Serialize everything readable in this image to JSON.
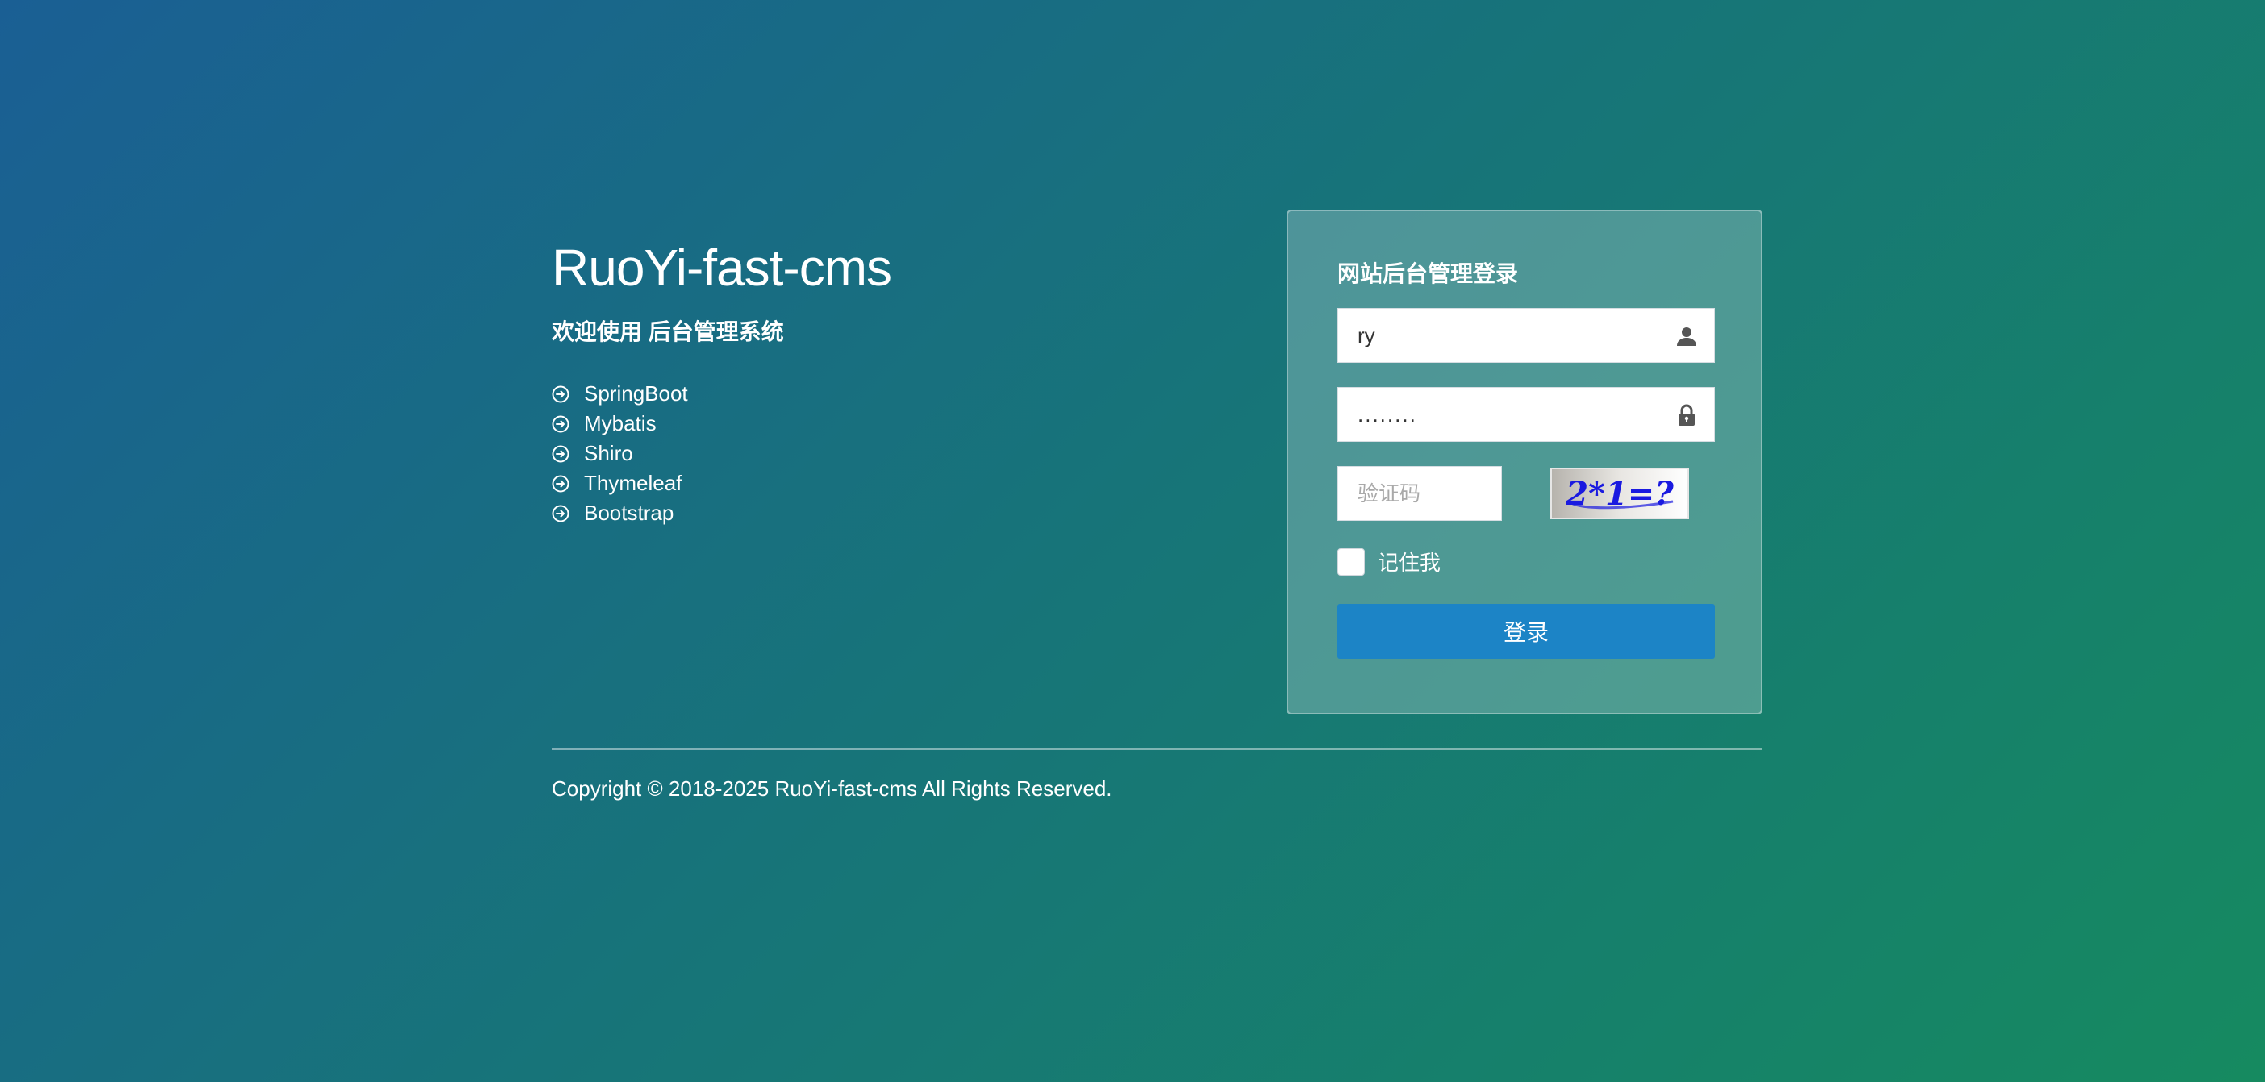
{
  "intro": {
    "brand": "RuoYi-fast-cms",
    "welcome": "欢迎使用 后台管理系统",
    "technologies": [
      "SpringBoot",
      "Mybatis",
      "Shiro",
      "Thymeleaf",
      "Bootstrap"
    ]
  },
  "login": {
    "title": "网站后台管理登录",
    "username": {
      "value": "ry",
      "icon": "user-icon"
    },
    "password": {
      "value": "........",
      "icon": "lock-icon"
    },
    "captcha": {
      "placeholder": "验证码",
      "image_text": "2*1=?"
    },
    "remember_label": "记住我",
    "submit_label": "登录"
  },
  "footer": {
    "copyright": "Copyright © 2018-2025 RuoYi-fast-cms All Rights Reserved."
  },
  "colors": {
    "background_start": "#1a5f94",
    "background_end": "#168a60",
    "button": "#1c84c6",
    "captcha_text": "#1a1ae0"
  }
}
